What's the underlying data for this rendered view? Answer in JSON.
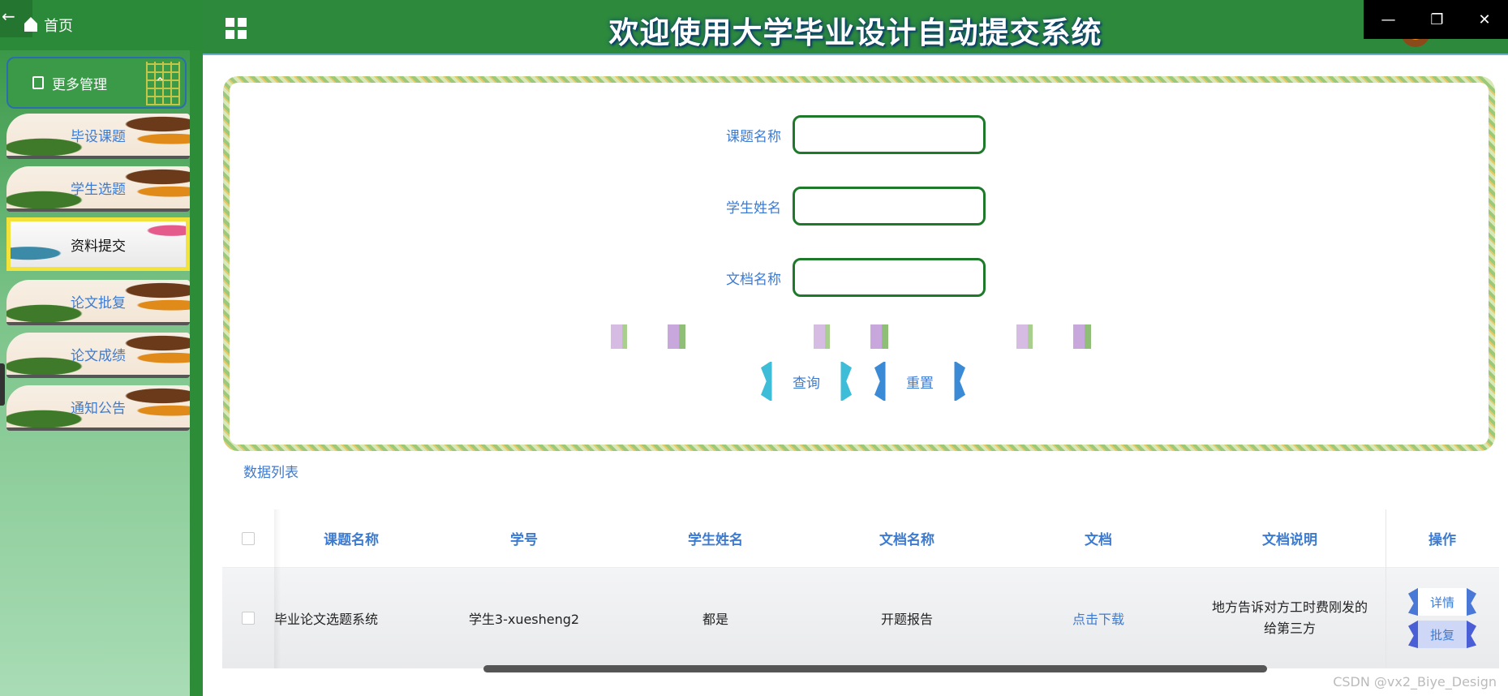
{
  "window": {
    "minimize_glyph": "—",
    "restore_glyph": "❐",
    "close_glyph": "✕",
    "back_glyph": "←"
  },
  "header": {
    "title": "欢迎使用大学毕业设计自动提交系统"
  },
  "sidebar": {
    "home_label": "首页",
    "group_label": "更多管理",
    "items": [
      {
        "label": "毕设课题"
      },
      {
        "label": "学生选题"
      },
      {
        "label": "资料提交",
        "active": true
      },
      {
        "label": "论文批复"
      },
      {
        "label": "论文成绩"
      },
      {
        "label": "通知公告"
      }
    ]
  },
  "search": {
    "fields": [
      {
        "label": "课题名称",
        "value": ""
      },
      {
        "label": "学生姓名",
        "value": ""
      },
      {
        "label": "文档名称",
        "value": ""
      }
    ],
    "query_label": "查询",
    "reset_label": "重置"
  },
  "list": {
    "title": "数据列表",
    "columns": [
      "课题名称",
      "学号",
      "学生姓名",
      "文档名称",
      "文档",
      "文档说明",
      "操作"
    ],
    "rows": [
      {
        "topic": "毕业论文选题系统",
        "student_no": "学生3-xuesheng2",
        "student_name": "都是",
        "doc_name": "开题报告",
        "doc_link": "点击下载",
        "doc_desc": "地方告诉对方工时费刚发的给第三方",
        "action_detail": "详情",
        "action_reply": "批复"
      }
    ]
  },
  "watermark": "CSDN @vx2_Biye_Design",
  "colors": {
    "accent_blue": "#3d7bd1",
    "header_green": "#2d8a3d",
    "input_border": "#1e7a2a"
  }
}
